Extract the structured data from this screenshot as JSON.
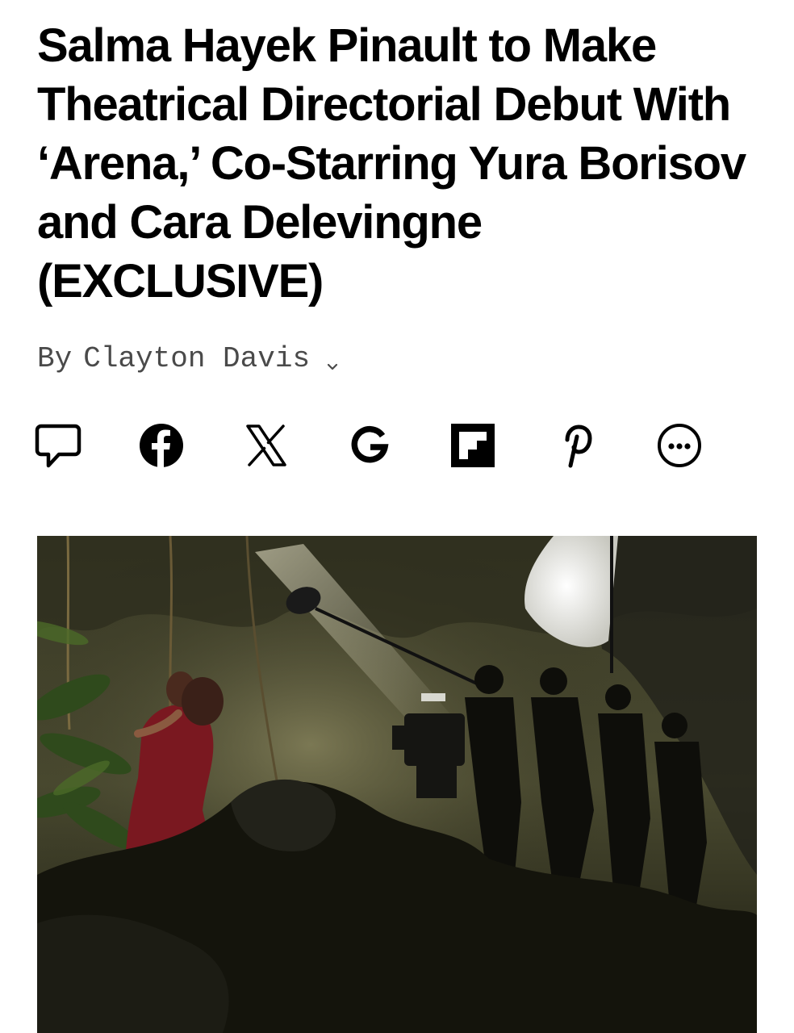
{
  "article": {
    "headline": "Salma Hayek Pinault to Make Theatrical Directorial Debut With ‘Arena,’ Co-Starring Yura Borisov and Cara Delevingne (EXCLUSIVE)",
    "byline_prefix": "By",
    "author": "Clayton Davis"
  },
  "share_bar": {
    "items": [
      {
        "icon": "comment-icon"
      },
      {
        "icon": "facebook-icon"
      },
      {
        "icon": "x-icon"
      },
      {
        "icon": "google-icon"
      },
      {
        "icon": "flipboard-icon"
      },
      {
        "icon": "pinterest-icon"
      },
      {
        "icon": "more-icon"
      }
    ]
  },
  "hero_image": {
    "icon": "photo-film-set-cave"
  },
  "colors": {
    "text": "#000000",
    "byline": "#4a4a4a",
    "background": "#ffffff"
  }
}
